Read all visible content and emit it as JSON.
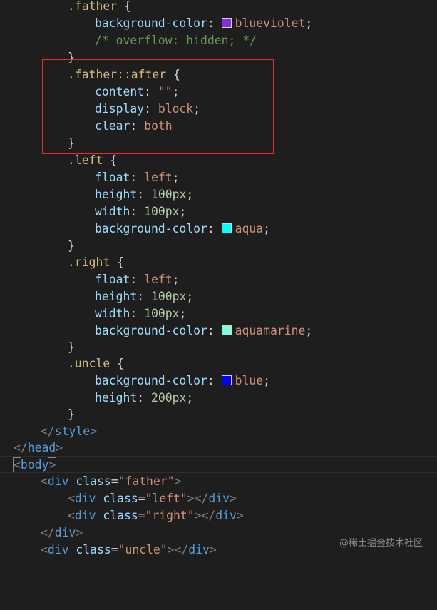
{
  "colors": {
    "blueviolet": "#8a2be2",
    "aqua": "#00ffff",
    "aquamarine": "#7fffd4",
    "blue": "#0000ff"
  },
  "lines": {
    "l1": {
      "sel": ".father",
      "brace": " {"
    },
    "l2": {
      "prop": "background-color",
      "colon": ": ",
      "val": "blueviolet",
      "semi": ";"
    },
    "l3": {
      "comment": "/* overflow: hidden; */"
    },
    "l4": {
      "brace": "}"
    },
    "l5": {
      "sel": ".father::after",
      "brace": " {"
    },
    "l6": {
      "prop": "content",
      "colon": ": ",
      "val": "\"\"",
      "semi": ";"
    },
    "l7": {
      "prop": "display",
      "colon": ": ",
      "val": "block",
      "semi": ";"
    },
    "l8": {
      "prop": "clear",
      "colon": ": ",
      "val": "both"
    },
    "l9": {
      "brace": "}"
    },
    "l10": {
      "sel": ".left",
      "brace": " {"
    },
    "l11": {
      "prop": "float",
      "colon": ": ",
      "val": "left",
      "semi": ";"
    },
    "l12": {
      "prop": "height",
      "colon": ": ",
      "num": "100px",
      "semi": ";"
    },
    "l13": {
      "prop": "width",
      "colon": ": ",
      "num": "100px",
      "semi": ";"
    },
    "l14": {
      "prop": "background-color",
      "colon": ": ",
      "val": "aqua",
      "semi": ";"
    },
    "l15": {
      "brace": "}"
    },
    "l16": {
      "sel": ".right",
      "brace": " {"
    },
    "l17": {
      "prop": "float",
      "colon": ": ",
      "val": "left",
      "semi": ";"
    },
    "l18": {
      "prop": "height",
      "colon": ": ",
      "num": "100px",
      "semi": ";"
    },
    "l19": {
      "prop": "width",
      "colon": ": ",
      "num": "100px",
      "semi": ";"
    },
    "l20": {
      "prop": "background-color",
      "colon": ": ",
      "val": "aquamarine",
      "semi": ";"
    },
    "l21": {
      "brace": "}"
    },
    "l22": {
      "sel": ".uncle",
      "brace": " {"
    },
    "l23": {
      "prop": "background-color",
      "colon": ": ",
      "val": "blue",
      "semi": ";"
    },
    "l24": {
      "prop": "height",
      "colon": ": ",
      "num": "200px",
      "semi": ";"
    },
    "l25": {
      "brace": "}"
    },
    "l26": {
      "open": "</",
      "tag": "style",
      "close": ">"
    },
    "l27": {
      "open": "</",
      "tag": "head",
      "close": ">"
    },
    "l28": {
      "open": "<",
      "tag": "body",
      "close": ">"
    },
    "l29": {
      "open": "<",
      "tag": "div",
      "sp": " ",
      "attr": "class",
      "eq": "=",
      "aval": "\"father\"",
      "close": ">"
    },
    "l30": {
      "open": "<",
      "tag": "div",
      "sp": " ",
      "attr": "class",
      "eq": "=",
      "aval": "\"left\"",
      "close": ">",
      "open2": "</",
      "tag2": "div",
      "close2": ">"
    },
    "l31": {
      "open": "<",
      "tag": "div",
      "sp": " ",
      "attr": "class",
      "eq": "=",
      "aval": "\"right\"",
      "close": ">",
      "open2": "</",
      "tag2": "div",
      "close2": ">"
    },
    "l32": {
      "open": "</",
      "tag": "div",
      "close": ">"
    },
    "l33": {
      "open": "<",
      "tag": "div",
      "sp": " ",
      "attr": "class",
      "eq": "=",
      "aval": "\"uncle\"",
      "close": ">",
      "open2": "</",
      "tag2": "div",
      "close2": ">"
    }
  },
  "watermark": "@稀土掘金技术社区"
}
